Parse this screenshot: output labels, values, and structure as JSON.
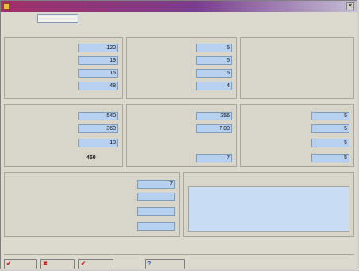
{
  "window": {
    "title": "",
    "close_glyph": "×"
  },
  "header": {
    "label": "",
    "value": ""
  },
  "panel1": {
    "rows": [
      {
        "label": "",
        "value": "120"
      },
      {
        "label": "",
        "value": "19"
      },
      {
        "label": "",
        "value": "15"
      },
      {
        "label": "",
        "value": "48"
      }
    ]
  },
  "panel2": {
    "rows": [
      {
        "label": "",
        "value": "5"
      },
      {
        "label": "",
        "value": "5"
      },
      {
        "label": "",
        "value": "5"
      },
      {
        "label": "",
        "value": "4"
      }
    ]
  },
  "panel3": {
    "title": "",
    "lines": [
      "",
      "",
      ""
    ]
  },
  "panel4": {
    "rows": [
      {
        "label": "",
        "value": "540"
      },
      {
        "label": "",
        "value": "360"
      },
      {
        "label": "",
        "value": "10"
      },
      {
        "label": "",
        "value": "450"
      }
    ]
  },
  "panel5": {
    "rows": [
      {
        "label": "",
        "value": "356"
      },
      {
        "label": "",
        "value": "7,00"
      },
      {
        "label": "",
        "value": "7"
      }
    ]
  },
  "panel6": {
    "rows": [
      {
        "label": "",
        "value": "5"
      },
      {
        "label": "",
        "value": "5"
      },
      {
        "label": "",
        "value": "5"
      },
      {
        "label": "",
        "value": "5"
      }
    ]
  },
  "panel7": {
    "rows": [
      {
        "label": "",
        "value": "7"
      },
      {
        "label": "",
        "value": ""
      },
      {
        "label": "",
        "value": ""
      },
      {
        "label": "",
        "value": ""
      }
    ]
  },
  "observations": {
    "label": "",
    "line1": "",
    "line2": ""
  },
  "buttons": [
    {
      "label": "",
      "glyph": "✔"
    },
    {
      "label": "",
      "glyph": "✖"
    },
    {
      "label": "",
      "glyph": "✔"
    },
    {
      "label": "",
      "glyph": "?"
    }
  ]
}
